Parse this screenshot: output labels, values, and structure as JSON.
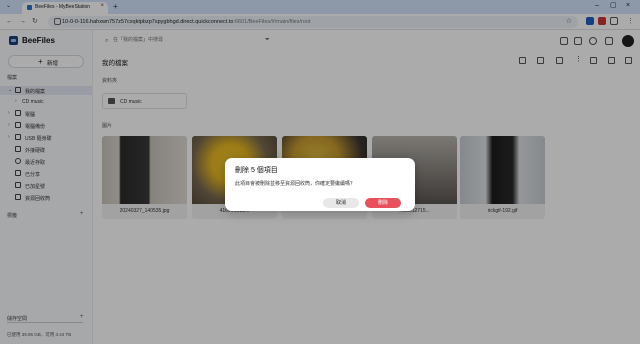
{
  "browser": {
    "tab_title": "BeeFiles - MyBeeStation",
    "new_tab": "+",
    "url_host": "10-0-0-116.hahxwn757z57cxqktpbzp7spygbhgd.direct.quickconnect.to",
    "url_path": ":6601/BeeFiles/#/main/files/root"
  },
  "app": {
    "brand": "BeeFiles",
    "new_button": "新增",
    "search_placeholder": "在「我的檔案」中搜尋"
  },
  "sidebar": {
    "section_files": "檔案",
    "items": [
      {
        "label": "我的檔案",
        "active": true
      },
      {
        "label": "CD music",
        "sub": true
      },
      {
        "label": "電腦"
      },
      {
        "label": "電腦備份"
      },
      {
        "label": "USB 隨身碟"
      },
      {
        "label": "外接硬碟"
      },
      {
        "label": "最近存取"
      },
      {
        "label": "已分享"
      },
      {
        "label": "已加星號"
      },
      {
        "label": "資源回收筒"
      }
    ],
    "section_tags": "標籤",
    "section_storage": "儲存空間",
    "storage_text": "已使用 39.96 GB，可用 3.44 TB"
  },
  "main": {
    "title": "我的檔案",
    "folders_label": "資料夾",
    "folder_name": "CD music",
    "images_label": "圖片",
    "images": [
      {
        "caption": "20240327_140535.jpg"
      },
      {
        "caption": "41690031B..."
      },
      {
        "caption": ""
      },
      {
        "caption": "...35512715..."
      },
      {
        "caption": "rickgif-192.gif"
      }
    ]
  },
  "dialog": {
    "title": "刪除 5 個項目",
    "message": "此項目會被刪除並移至資源回收筒，你確定要繼續嗎？",
    "cancel": "取消",
    "delete": "刪除"
  },
  "colors": {
    "accent": "#1d3f7a",
    "delete": "#e8505b",
    "tabbar": "#d3e3fd"
  }
}
